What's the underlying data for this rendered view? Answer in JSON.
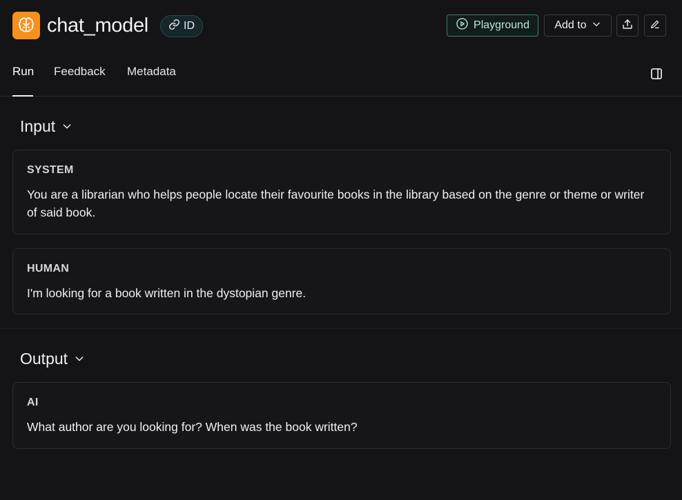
{
  "header": {
    "title": "chat_model",
    "id_badge": "ID",
    "playground_label": "Playground",
    "add_to_label": "Add to",
    "logo_color": "#f7901e"
  },
  "tabs": [
    {
      "label": "Run",
      "active": true
    },
    {
      "label": "Feedback",
      "active": false
    },
    {
      "label": "Metadata",
      "active": false
    }
  ],
  "input": {
    "heading": "Input",
    "messages": [
      {
        "role": "SYSTEM",
        "text": "You are a librarian who helps people locate their favourite books in the library based on the genre or theme or writer of said book."
      },
      {
        "role": "HUMAN",
        "text": "I'm looking for a book written in the dystopian genre."
      }
    ]
  },
  "output": {
    "heading": "Output",
    "messages": [
      {
        "role": "AI",
        "text": "What author are you looking for? When was the book written?"
      }
    ]
  },
  "icons": {
    "logo": "brain-icon",
    "id_badge": "link-icon",
    "playground": "play-circle-icon",
    "add_to": "chevron-down-icon",
    "share": "upload-icon",
    "edit": "pencil-icon",
    "panel_toggle": "sidebar-panel-icon"
  }
}
